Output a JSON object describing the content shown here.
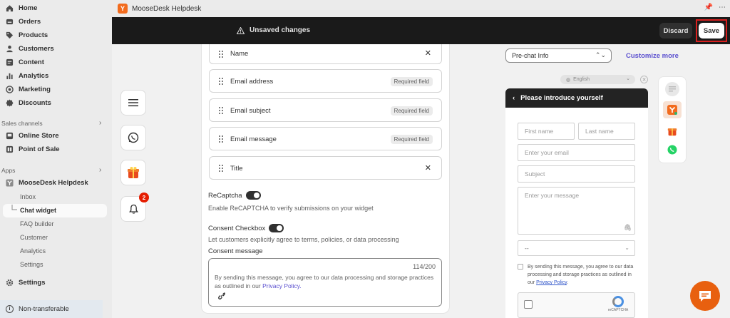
{
  "app": {
    "title": "MooseDesk Helpdesk",
    "logo_letter": "Y"
  },
  "unsaved_bar": {
    "message": "Unsaved changes",
    "discard_label": "Discard",
    "save_label": "Save"
  },
  "sidebar": {
    "main_items": [
      {
        "label": "Home",
        "icon": "home-icon"
      },
      {
        "label": "Orders",
        "icon": "orders-icon"
      },
      {
        "label": "Products",
        "icon": "tag-icon"
      },
      {
        "label": "Customers",
        "icon": "person-icon"
      },
      {
        "label": "Content",
        "icon": "content-icon"
      },
      {
        "label": "Analytics",
        "icon": "bar-chart-icon"
      },
      {
        "label": "Marketing",
        "icon": "target-icon"
      },
      {
        "label": "Discounts",
        "icon": "discount-icon"
      }
    ],
    "sales_channels_label": "Sales channels",
    "sales_channels": [
      {
        "label": "Online Store",
        "icon": "store-icon"
      },
      {
        "label": "Point of Sale",
        "icon": "pos-icon"
      }
    ],
    "apps_label": "Apps",
    "app_name": "MooseDesk Helpdesk",
    "app_sub_items": [
      "Inbox",
      "Chat widget",
      "FAQ builder",
      "Customer",
      "Analytics",
      "Settings"
    ],
    "settings_label": "Settings",
    "non_transferable_label": "Non-transferable"
  },
  "form": {
    "fields": [
      {
        "label": "Name",
        "required": "",
        "removable": true
      },
      {
        "label": "Email address",
        "required": "Required field",
        "removable": false
      },
      {
        "label": "Email subject",
        "required": "Required field",
        "removable": false
      },
      {
        "label": "Email message",
        "required": "Required field",
        "removable": false
      },
      {
        "label": "Title",
        "required": "",
        "removable": true
      }
    ],
    "recaptcha_label": "ReCaptcha",
    "recaptcha_help": "Enable ReCAPTCHA to verify submissions on your widget",
    "consent_label": "Consent Checkbox",
    "consent_help": "Let customers explicitly agree to terms, policies, or data processing",
    "consent_message_label": "Consent message",
    "consent_count": "114/200",
    "consent_text": "By sending this message, you agree to our data processing and storage practices as outlined in our ",
    "consent_link": "Privacy Policy.",
    "notification_count": "2"
  },
  "preview": {
    "select_value": "Pre-chat Info",
    "customize_label": "Customize more",
    "language": "English",
    "widget_title": "Please introduce yourself",
    "first_name": "First name",
    "last_name": "Last name",
    "email_placeholder": "Enter your email",
    "subject_placeholder": "Subject",
    "message_placeholder": "Enter your message",
    "select_placeholder": "--",
    "consent_text": "By sending this message, you agree to our data processing and storage practices as outlined in our ",
    "consent_link": "Privacy Policy",
    "consent_end": ".",
    "recaptcha_brand": "reCAPTCHA"
  },
  "colors": {
    "accent": "#5a4fcf",
    "brand_orange": "#e8600f",
    "dark_bar": "#1a1a1a",
    "badge_red": "#e51c00"
  }
}
